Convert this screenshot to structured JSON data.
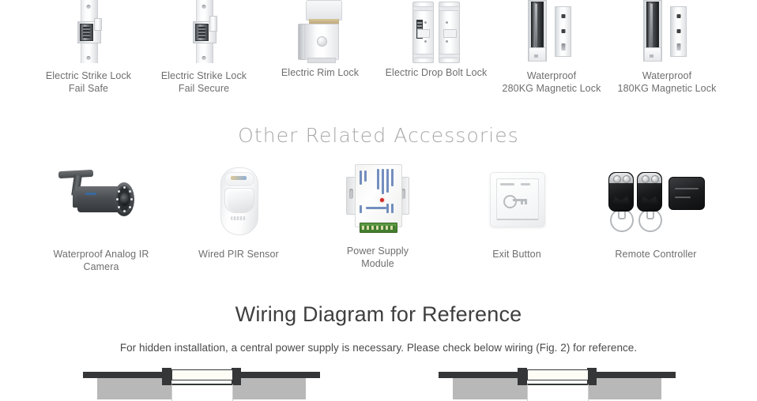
{
  "locks_row": {
    "items": [
      {
        "caption": "Electric Strike Lock\nFail Safe",
        "line1": "Electric Strike Lock",
        "line2": "Fail Safe",
        "icon": "electric-strike-lock-fail-safe"
      },
      {
        "caption": "Electric Strike Lock\nFail Secure",
        "line1": "Electric Strike Lock",
        "line2": "Fail Secure",
        "icon": "electric-strike-lock-fail-secure"
      },
      {
        "caption": "Electric Rim Lock",
        "line1": "Electric Rim Lock",
        "line2": "",
        "icon": "electric-rim-lock"
      },
      {
        "caption": "Electric Drop Bolt Lock",
        "line1": "Electric Drop Bolt Lock",
        "line2": "",
        "icon": "electric-drop-bolt-lock"
      },
      {
        "caption": "Waterproof\n280KG Magnetic Lock",
        "line1": "Waterproof",
        "line2": "280KG Magnetic Lock",
        "icon": "waterproof-280kg-magnetic-lock"
      },
      {
        "caption": "Waterproof\n180KG Magnetic Lock",
        "line1": "Waterproof",
        "line2": "180KG Magnetic Lock",
        "icon": "waterproof-180kg-magnetic-lock"
      }
    ]
  },
  "accessories_section": {
    "title": "Other Related Accessories",
    "items": [
      {
        "line1": "Waterproof Analog IR Camera",
        "line2": "",
        "icon": "waterproof-analog-ir-camera"
      },
      {
        "line1": "Wired PIR Sensor",
        "line2": "",
        "icon": "wired-pir-sensor"
      },
      {
        "line1": "Power Supply",
        "line2": "Module",
        "icon": "power-supply-module"
      },
      {
        "line1": "Exit Button",
        "line2": "",
        "icon": "exit-button"
      },
      {
        "line1": "Remote Controller",
        "line2": "",
        "icon": "remote-controller"
      }
    ]
  },
  "wiring_section": {
    "title": "Wiring Diagram for Reference",
    "subtitle": "For hidden installation, a central power supply is necessary. Please check below wiring (Fig. 2) for reference."
  },
  "colors": {
    "background": "#ffffff",
    "caption_text": "#6e6e6e",
    "section_title_light": "#a8a8a8",
    "heading_text": "#3f3f3f",
    "subtitle_text": "#4a4a4a",
    "diagram_dark": "#343638",
    "diagram_wall": "#b8b8b8"
  }
}
